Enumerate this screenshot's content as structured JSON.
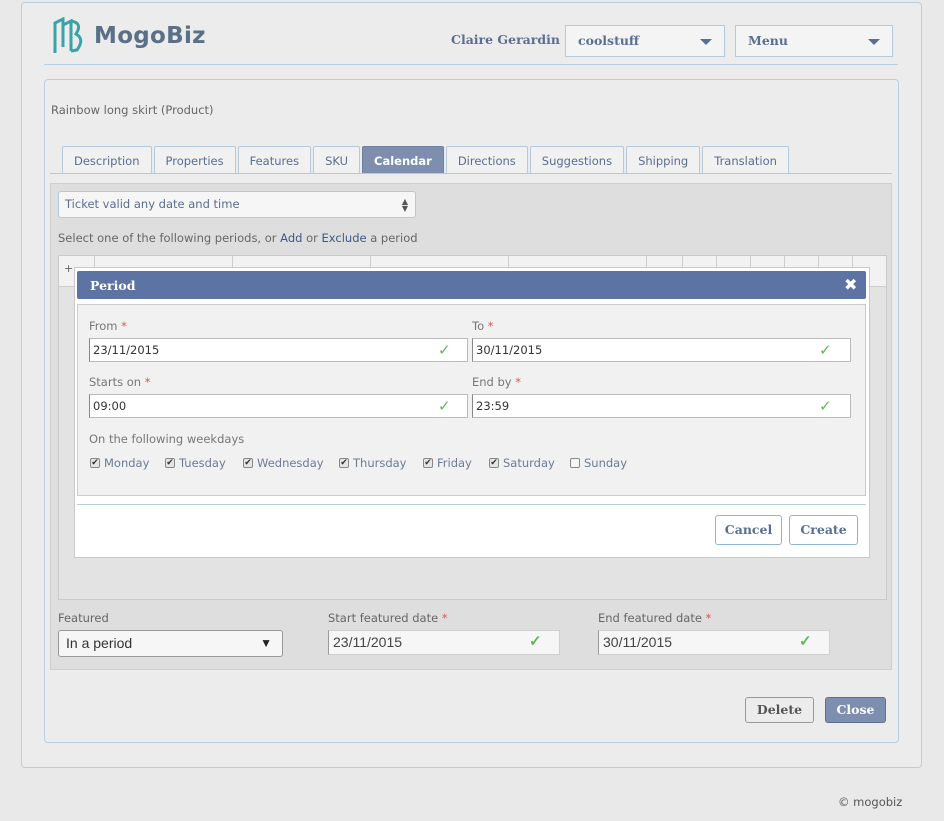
{
  "header": {
    "app_name": "MogoBiz",
    "user_name": "Claire Gerardin",
    "store_select": "coolstuff",
    "menu_select": "Menu"
  },
  "product": {
    "title": "Rainbow long skirt (Product)"
  },
  "tabs": [
    {
      "label": "Description"
    },
    {
      "label": "Properties"
    },
    {
      "label": "Features"
    },
    {
      "label": "SKU"
    },
    {
      "label": "Calendar",
      "active": true
    },
    {
      "label": "Directions"
    },
    {
      "label": "Suggestions"
    },
    {
      "label": "Shipping"
    },
    {
      "label": "Translation"
    }
  ],
  "calendar": {
    "ticket_type": "Ticket valid any date and time",
    "instructions_prefix": "Select one of the following periods, or",
    "add_link": "Add",
    "or_text": "or",
    "exclude_link": "Exclude",
    "instructions_suffix": "a period",
    "table_first_header": "+"
  },
  "featured": {
    "label": "Featured",
    "value": "In a period",
    "start_label": "Start featured date",
    "start_value": "23/11/2015",
    "end_label": "End featured date",
    "end_value": "30/11/2015",
    "required_mark": "*"
  },
  "footer_buttons": {
    "delete": "Delete",
    "close": "Close"
  },
  "copyright": "© mogobiz",
  "modal": {
    "title": "Period",
    "close_glyph": "✖",
    "from_label": "From",
    "from_value": "23/11/2015",
    "to_label": "To",
    "to_value": "30/11/2015",
    "starts_label": "Starts on",
    "starts_value": "09:00",
    "end_label": "End by",
    "end_value": "23:59",
    "weekdays_label": "On the following weekdays",
    "weekdays": [
      {
        "label": "Monday",
        "checked": true
      },
      {
        "label": "Tuesday",
        "checked": true
      },
      {
        "label": "Wednesday",
        "checked": true
      },
      {
        "label": "Thursday",
        "checked": true
      },
      {
        "label": "Friday",
        "checked": true
      },
      {
        "label": "Saturday",
        "checked": true
      },
      {
        "label": "Sunday",
        "checked": false
      }
    ],
    "cancel": "Cancel",
    "create": "Create"
  },
  "colors": {
    "accent": "#5c73a4",
    "active_tab": "#7d8eae",
    "valid_check": "#5cb85c",
    "required": "#d9534f"
  }
}
